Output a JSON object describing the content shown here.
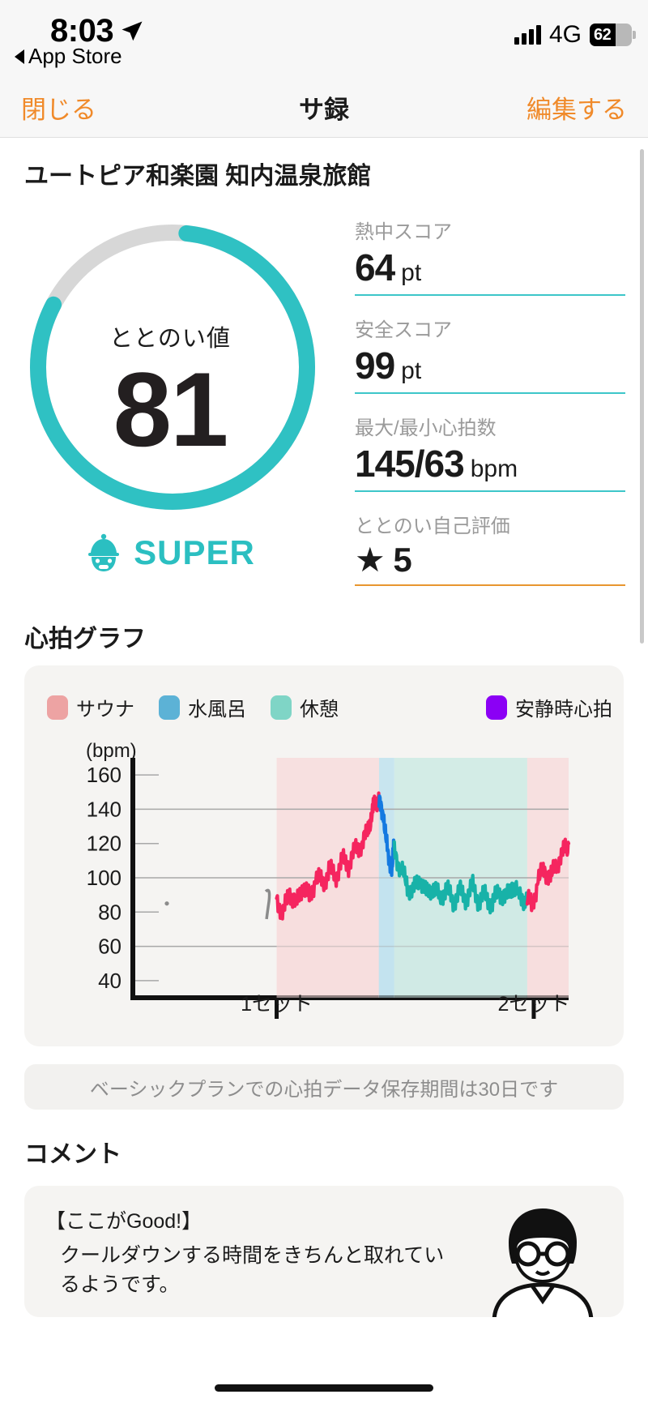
{
  "status_bar": {
    "time": "8:03",
    "back_app": "App Store",
    "network": "4G",
    "battery_percent": "62",
    "location_icon": "location-arrow-icon",
    "signal_icon": "signal-bars-icon"
  },
  "nav": {
    "left_label": "閉じる",
    "title": "サ録",
    "right_label": "編集する",
    "accent_color": "#f08a2a"
  },
  "venue": {
    "name": "ユートピア和楽園 知内温泉旅館"
  },
  "ring": {
    "label": "ととのい値",
    "value": "81",
    "percent": 81,
    "arc_color": "#2fc1c3",
    "track_color": "#d7d7d7",
    "rank_label": "SUPER",
    "rank_icon": "sauna-character-icon"
  },
  "stats": [
    {
      "label": "熱中スコア",
      "value": "64",
      "unit": "pt",
      "rule_color": "#3dc6c9"
    },
    {
      "label": "安全スコア",
      "value": "99",
      "unit": "pt",
      "rule_color": "#3dc6c9"
    },
    {
      "label": "最大/最小心拍数",
      "value": "145/63",
      "unit": "bpm",
      "rule_color": "#3dc6c9"
    },
    {
      "label": "ととのい自己評価",
      "value": "★ 5",
      "unit": "",
      "rule_color": "#e8962f"
    }
  ],
  "chart_section": {
    "title": "心拍グラフ",
    "notice": "ベーシックプランでの心拍データ保存期間は30日です"
  },
  "chart_data": {
    "type": "line",
    "title": "心拍グラフ",
    "ylabel": "(bpm)",
    "xlabel": "",
    "ylim": [
      30,
      170
    ],
    "yticks": [
      160,
      140,
      120,
      100,
      80,
      60,
      40
    ],
    "gridlines": [
      140,
      100,
      60
    ],
    "minor_ticks": [
      160,
      120,
      80,
      40
    ],
    "x_tick_labels": [
      "1セット",
      "2セット"
    ],
    "x_tick_positions": [
      0.33,
      0.92
    ],
    "legend": [
      {
        "name": "サウナ",
        "color": "#eda3a3"
      },
      {
        "name": "水風呂",
        "color": "#5cb2d6"
      },
      {
        "name": "休憩",
        "color": "#7fd5c6"
      },
      {
        "name": "安静時心拍",
        "color": "#8b00f5"
      }
    ],
    "legend_position": "top",
    "zones": [
      {
        "name": "サウナ",
        "x_start": 0.33,
        "x_end": 0.565,
        "fill": "#f7dcdd",
        "line_color": "#f5255f"
      },
      {
        "name": "水風呂",
        "x_start": 0.565,
        "x_end": 0.6,
        "fill": "#bfe2ef",
        "line_color": "#1479e0"
      },
      {
        "name": "休憩",
        "x_start": 0.6,
        "x_end": 0.905,
        "fill": "#cdeae4",
        "line_color": "#18b2a8"
      },
      {
        "name": "サウナ",
        "x_start": 0.905,
        "x_end": 1.0,
        "fill": "#f7dcdd",
        "line_color": "#f5255f"
      }
    ],
    "resting_hr": 85,
    "series": [
      {
        "name": "心拍数",
        "x": [
          0.33,
          0.345,
          0.36,
          0.375,
          0.39,
          0.405,
          0.42,
          0.435,
          0.45,
          0.465,
          0.48,
          0.495,
          0.51,
          0.525,
          0.54,
          0.55,
          0.558,
          0.565,
          0.575,
          0.585,
          0.595,
          0.6,
          0.615,
          0.63,
          0.645,
          0.66,
          0.675,
          0.69,
          0.705,
          0.72,
          0.735,
          0.75,
          0.765,
          0.78,
          0.795,
          0.81,
          0.825,
          0.84,
          0.855,
          0.87,
          0.885,
          0.9,
          0.915,
          0.93,
          0.945,
          0.96,
          0.975,
          0.99,
          1.0
        ],
        "values": [
          88,
          79,
          92,
          84,
          96,
          88,
          100,
          97,
          104,
          101,
          110,
          108,
          116,
          119,
          128,
          140,
          145,
          143,
          138,
          112,
          108,
          118,
          104,
          96,
          92,
          100,
          90,
          95,
          88,
          94,
          86,
          92,
          88,
          95,
          86,
          90,
          84,
          93,
          87,
          96,
          90,
          88,
          84,
          98,
          105,
          100,
          110,
          116,
          120
        ]
      }
    ]
  },
  "comment_section": {
    "title": "コメント",
    "line1": "【ここがGood!】",
    "line2": "クールダウンする時間をきちんと取れているようです。",
    "avatar_icon": "person-avatar-icon"
  }
}
